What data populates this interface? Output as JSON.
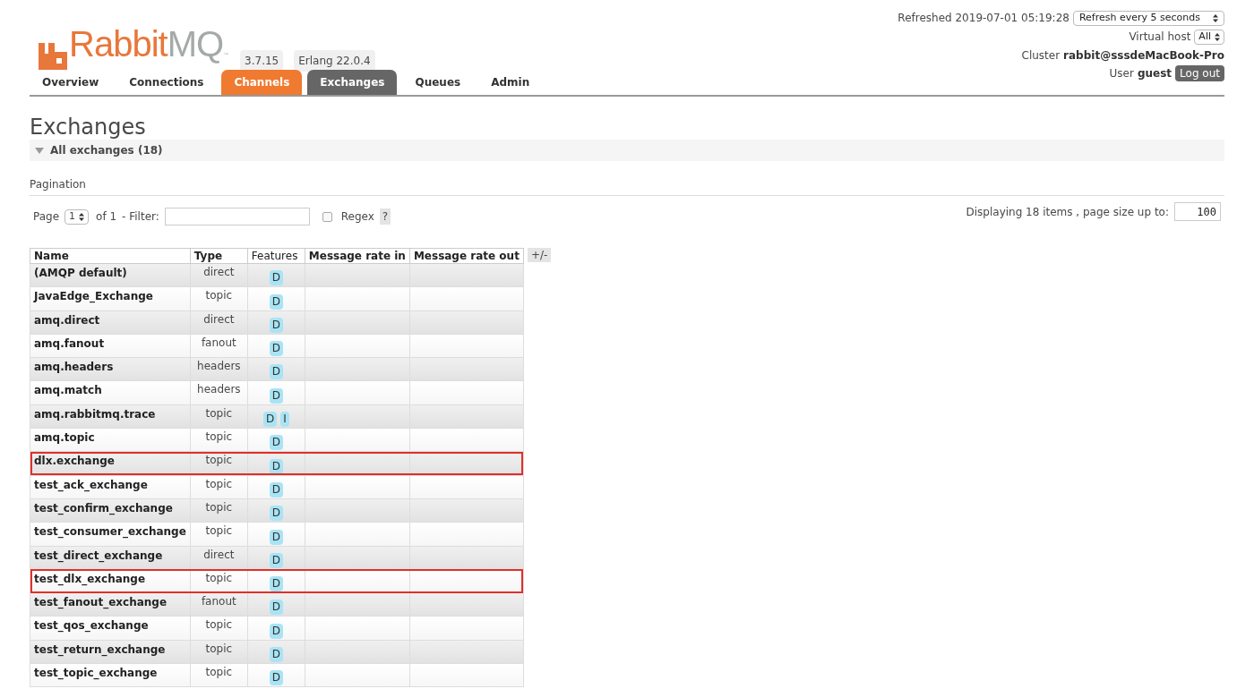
{
  "logo": {
    "word_1": "Rabbit",
    "word_2": "MQ",
    "mark": "™"
  },
  "versions": [
    "3.7.15",
    "Erlang 22.0.4"
  ],
  "header": {
    "refreshed": "Refreshed 2019-07-01 05:19:28",
    "refresh_select": "Refresh every 5 seconds",
    "vhost_label": "Virtual host",
    "vhost_select": "All",
    "cluster_label": "Cluster",
    "cluster": "rabbit@sssdeMacBook-Pro",
    "user_label": "User",
    "user": "guest",
    "logout": "Log out"
  },
  "tabs": [
    {
      "label": "Overview",
      "selected": false,
      "hovered": false
    },
    {
      "label": "Connections",
      "selected": false,
      "hovered": false
    },
    {
      "label": "Channels",
      "selected": false,
      "hovered": true
    },
    {
      "label": "Exchanges",
      "selected": true,
      "hovered": false
    },
    {
      "label": "Queues",
      "selected": false,
      "hovered": false
    },
    {
      "label": "Admin",
      "selected": false,
      "hovered": false
    }
  ],
  "page_title": "Exchanges",
  "section": {
    "title": "All exchanges (18)",
    "expanded": true
  },
  "pagination": {
    "title": "Pagination",
    "page_label": "Page",
    "page": "1",
    "of": "of 1",
    "filter_label": "- Filter:",
    "regex_label": "Regex",
    "regex_checked": false,
    "help": "?",
    "displaying": "Displaying 18 items , page size up to:",
    "page_size": "100"
  },
  "table": {
    "columns": [
      "Name",
      "Type",
      "Features",
      "Message rate in",
      "Message rate out"
    ],
    "toggle": "+/-",
    "rows": [
      {
        "name": "(AMQP default)",
        "type": "direct",
        "features": [
          "D"
        ],
        "highlighted": false
      },
      {
        "name": "JavaEdge_Exchange",
        "type": "topic",
        "features": [
          "D"
        ],
        "highlighted": false
      },
      {
        "name": "amq.direct",
        "type": "direct",
        "features": [
          "D"
        ],
        "highlighted": false
      },
      {
        "name": "amq.fanout",
        "type": "fanout",
        "features": [
          "D"
        ],
        "highlighted": false
      },
      {
        "name": "amq.headers",
        "type": "headers",
        "features": [
          "D"
        ],
        "highlighted": false
      },
      {
        "name": "amq.match",
        "type": "headers",
        "features": [
          "D"
        ],
        "highlighted": false
      },
      {
        "name": "amq.rabbitmq.trace",
        "type": "topic",
        "features": [
          "D",
          "I"
        ],
        "highlighted": false
      },
      {
        "name": "amq.topic",
        "type": "topic",
        "features": [
          "D"
        ],
        "highlighted": false
      },
      {
        "name": "dlx.exchange",
        "type": "topic",
        "features": [
          "D"
        ],
        "highlighted": true
      },
      {
        "name": "test_ack_exchange",
        "type": "topic",
        "features": [
          "D"
        ],
        "highlighted": false
      },
      {
        "name": "test_confirm_exchange",
        "type": "topic",
        "features": [
          "D"
        ],
        "highlighted": false
      },
      {
        "name": "test_consumer_exchange",
        "type": "topic",
        "features": [
          "D"
        ],
        "highlighted": false
      },
      {
        "name": "test_direct_exchange",
        "type": "direct",
        "features": [
          "D"
        ],
        "highlighted": false
      },
      {
        "name": "test_dlx_exchange",
        "type": "topic",
        "features": [
          "D"
        ],
        "highlighted": true
      },
      {
        "name": "test_fanout_exchange",
        "type": "fanout",
        "features": [
          "D"
        ],
        "highlighted": false
      },
      {
        "name": "test_qos_exchange",
        "type": "topic",
        "features": [
          "D"
        ],
        "highlighted": false
      },
      {
        "name": "test_return_exchange",
        "type": "topic",
        "features": [
          "D"
        ],
        "highlighted": false
      },
      {
        "name": "test_topic_exchange",
        "type": "topic",
        "features": [
          "D"
        ],
        "highlighted": false
      }
    ]
  }
}
